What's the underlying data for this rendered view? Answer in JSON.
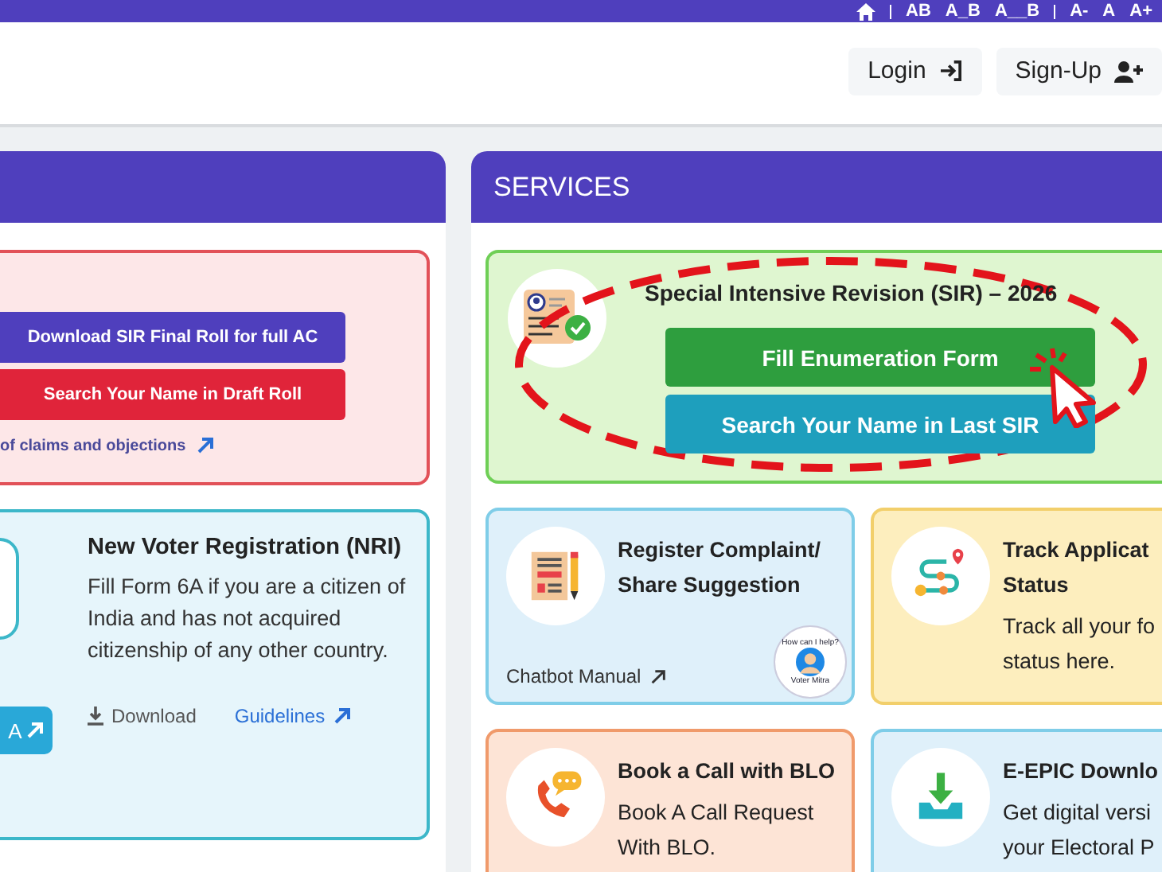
{
  "top_bar": {
    "spacing_options": [
      "AB",
      "A_B",
      "A__B"
    ],
    "size_options": [
      "A-",
      "A",
      "A+"
    ]
  },
  "header": {
    "buttons": [
      {
        "label": "Login",
        "kind": "login"
      },
      {
        "label": "Sign-Up",
        "kind": "signup"
      }
    ]
  },
  "left_panel": {
    "roll_card": {
      "buttons": [
        {
          "label": "Download SIR Final Roll for full AC",
          "kind": "primary"
        },
        {
          "label": "Search Your Name in Draft Roll",
          "kind": "danger"
        }
      ],
      "link": "of claims and objections"
    },
    "nri_card": {
      "title": "New Voter Registration (NRI)",
      "description": "Fill Form 6A if you are a citizen of India and has not acquired citizenship of any other country.",
      "apply_button": "A",
      "download": "Download",
      "guidelines": "Guidelines"
    }
  },
  "services": {
    "title": "SERVICES",
    "sir_card": {
      "title": "Special Intensive Revision (SIR) – 2026",
      "buttons": [
        {
          "label": "Fill Enumeration Form",
          "kind": "success"
        },
        {
          "label": "Search Your Name in Last SIR",
          "kind": "info"
        }
      ]
    },
    "cards": [
      {
        "kind": "complaint",
        "title_lines": [
          "Register Complaint/",
          "Share Suggestion"
        ],
        "link": "Chatbot Manual",
        "badge_top": "How can I help?",
        "badge_bottom": "Voter Mitra"
      },
      {
        "kind": "track",
        "title_lines": [
          "Track Applicat",
          "Status"
        ],
        "description_lines": [
          "Track all your fo",
          "status here."
        ]
      },
      {
        "kind": "call",
        "title_lines": [
          "Book a Call with BLO"
        ],
        "description_lines": [
          "Book A Call Request",
          "With BLO."
        ]
      },
      {
        "kind": "epic",
        "title_lines": [
          "E-EPIC Downlo"
        ],
        "description_lines": [
          "Get digital versi",
          "your Electoral P"
        ]
      }
    ]
  }
}
